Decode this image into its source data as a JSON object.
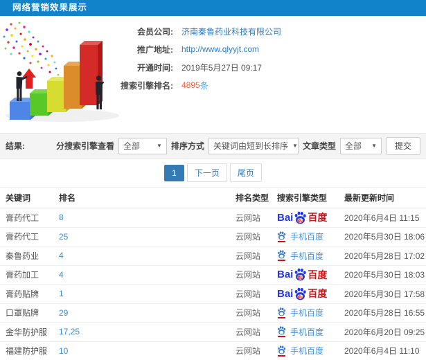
{
  "header": {
    "title": "网络营销效果展示"
  },
  "info": {
    "rows": [
      {
        "name": "member-company",
        "label": "会员公司:",
        "value": "济南秦鲁药业科技有限公司",
        "type": "link"
      },
      {
        "name": "promo-url",
        "label": "推广地址:",
        "value": "http://www.qlyyjt.com",
        "type": "link"
      },
      {
        "name": "open-time",
        "label": "开通时间:",
        "value": "2019年5月27日 09:17",
        "type": "text"
      },
      {
        "name": "engine-rank",
        "label": "搜索引擎排名:",
        "value": "4895",
        "unit": "条",
        "type": "highlight"
      }
    ]
  },
  "filters": {
    "result_label": "结果:",
    "engine_label": "分搜索引擎查看",
    "engine_value": "全部",
    "sort_label": "排序方式",
    "sort_value": "关键词由短到长排序",
    "article_label": "文章类型",
    "article_value": "全部",
    "submit_label": "提交",
    "caret": "▼"
  },
  "pagination": {
    "current": "1",
    "next": "下一页",
    "last": "尾页"
  },
  "table": {
    "headers": [
      "关键词",
      "排名",
      "排名类型",
      "搜索引擎类型",
      "最新更新时间"
    ],
    "engine_labels": {
      "bai": "Bai",
      "du": "du",
      "cn": "百度",
      "mobile": "手机百度"
    },
    "rows": [
      {
        "keyword": "膏药代工",
        "rank": "8",
        "rank_type": "云网站",
        "engine": "baidu",
        "updated": "2020年6月4日 11:15"
      },
      {
        "keyword": "膏药代工",
        "rank": "25",
        "rank_type": "云网站",
        "engine": "mobile",
        "updated": "2020年5月30日 18:06"
      },
      {
        "keyword": "秦鲁药业",
        "rank": "4",
        "rank_type": "云网站",
        "engine": "mobile",
        "updated": "2020年5月28日 17:02"
      },
      {
        "keyword": "膏药加工",
        "rank": "4",
        "rank_type": "云网站",
        "engine": "baidu",
        "updated": "2020年5月30日 18:03"
      },
      {
        "keyword": "膏药贴牌",
        "rank": "1",
        "rank_type": "云网站",
        "engine": "baidu",
        "updated": "2020年5月30日 17:58"
      },
      {
        "keyword": "口罩贴牌",
        "rank": "29",
        "rank_type": "云网站",
        "engine": "mobile",
        "updated": "2020年5月28日 16:55"
      },
      {
        "keyword": "金华防护服",
        "rank": "17,25",
        "rank_type": "云网站",
        "engine": "mobile",
        "updated": "2020年6月20日 09:25"
      },
      {
        "keyword": "福建防护服",
        "rank": "10",
        "rank_type": "云网站",
        "engine": "mobile",
        "updated": "2020年6月4日 11:10"
      }
    ]
  },
  "colors": {
    "topbar": "#1083ca",
    "link": "#2d7dc5",
    "highlight_number": "#ff5a3a",
    "highlight_unit": "#45a6e8",
    "active_page": "#337ab7",
    "baidu_blue": "#2438e0",
    "baidu_red": "#d20f13",
    "mobile_baidu": "#4090e0"
  }
}
